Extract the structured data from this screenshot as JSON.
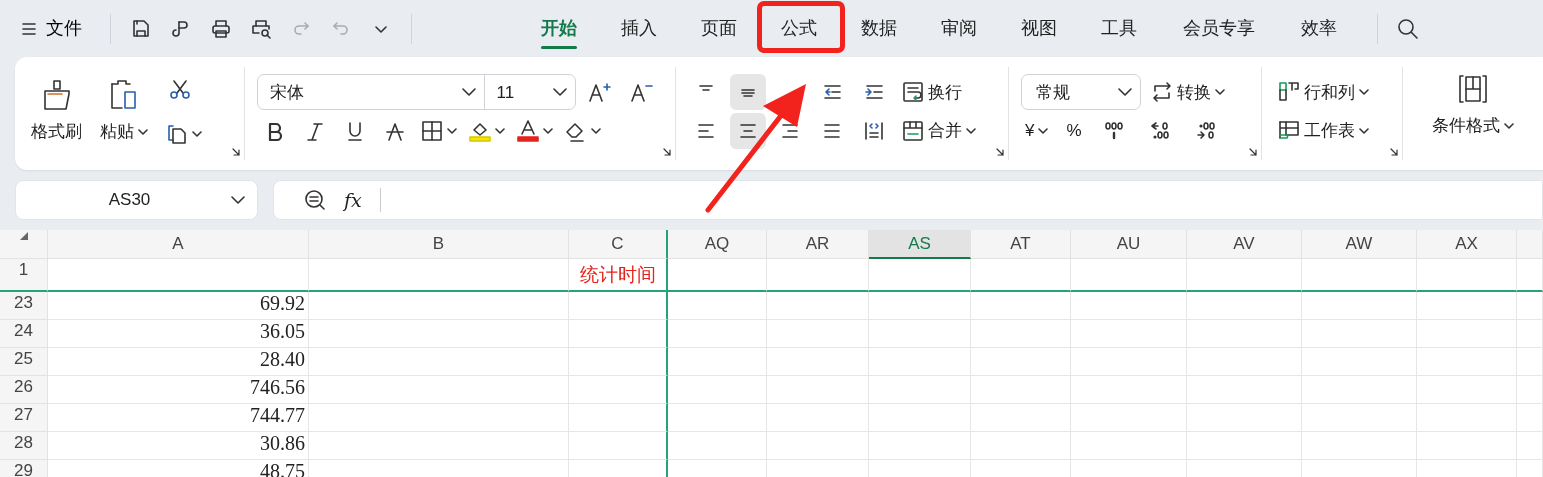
{
  "quick_access": {
    "menu_label": "文件",
    "tools": [
      {
        "kind": "save",
        "disabled": false
      },
      {
        "kind": "link",
        "disabled": false
      },
      {
        "kind": "print",
        "disabled": false
      },
      {
        "kind": "preview",
        "disabled": false
      },
      {
        "kind": "redo",
        "disabled": true
      },
      {
        "kind": "undo",
        "disabled": true
      },
      {
        "kind": "more",
        "disabled": false
      }
    ]
  },
  "tabs": [
    {
      "label": "开始",
      "selected": true,
      "highlighted": false
    },
    {
      "label": "插入",
      "selected": false,
      "highlighted": false
    },
    {
      "label": "页面",
      "selected": false,
      "highlighted": false
    },
    {
      "label": "公式",
      "selected": false,
      "highlighted": true
    },
    {
      "label": "数据",
      "selected": false,
      "highlighted": false
    },
    {
      "label": "审阅",
      "selected": false,
      "highlighted": false
    },
    {
      "label": "视图",
      "selected": false,
      "highlighted": false
    },
    {
      "label": "工具",
      "selected": false,
      "highlighted": false
    },
    {
      "label": "会员专享",
      "selected": false,
      "highlighted": false
    },
    {
      "label": "效率",
      "selected": false,
      "highlighted": false
    }
  ],
  "annotation_arrow": true,
  "clipboard": {
    "format_painter": "格式刷",
    "paste": "粘贴"
  },
  "font": {
    "name": "宋体",
    "size": "11"
  },
  "alignment": {
    "row_1": [
      {
        "kind": "top",
        "selected": false
      },
      {
        "kind": "middle",
        "selected": true
      },
      {
        "kind": "outdent",
        "selected": false
      },
      {
        "kind": "indent",
        "selected": false
      }
    ],
    "row_2": [
      {
        "kind": "left",
        "selected": false
      },
      {
        "kind": "center",
        "selected": true
      },
      {
        "kind": "right",
        "selected": false
      },
      {
        "kind": "justify",
        "selected": false
      },
      {
        "kind": "distributed",
        "selected": false
      }
    ],
    "wrap": "换行",
    "merge": "合并"
  },
  "number": {
    "format": "常规",
    "convert": "转换",
    "currency": "¥",
    "percent": "%"
  },
  "cells": {
    "rows_and_columns": "行和列",
    "worksheet": "工作表"
  },
  "styles": {
    "conditional_format": "条件格式"
  },
  "name_box": {
    "value": "AS30"
  },
  "formula_bar": {
    "label": "fx"
  },
  "sheet": {
    "columns": [
      {
        "label": "A",
        "selected": false
      },
      {
        "label": "B",
        "selected": false
      },
      {
        "label": "C",
        "selected": false
      },
      {
        "label": "AQ",
        "selected": false
      },
      {
        "label": "AR",
        "selected": false
      },
      {
        "label": "AS",
        "selected": true
      },
      {
        "label": "AT",
        "selected": false
      },
      {
        "label": "AU",
        "selected": false
      },
      {
        "label": "AV",
        "selected": false
      },
      {
        "label": "AW",
        "selected": false
      },
      {
        "label": "AX",
        "selected": false
      }
    ],
    "rows": [
      {
        "label": "1",
        "kind": "title",
        "cells": [
          "",
          "",
          "统计时间"
        ]
      },
      {
        "label": "23",
        "kind": "number",
        "cells": [
          "69.92"
        ]
      },
      {
        "label": "24",
        "kind": "number",
        "cells": [
          "36.05"
        ]
      },
      {
        "label": "25",
        "kind": "number",
        "cells": [
          "28.40"
        ]
      },
      {
        "label": "26",
        "kind": "number",
        "cells": [
          "746.56"
        ]
      },
      {
        "label": "27",
        "kind": "number",
        "cells": [
          "744.77"
        ]
      },
      {
        "label": "28",
        "kind": "number",
        "cells": [
          "30.86"
        ]
      },
      {
        "label": "29",
        "kind": "number",
        "cells": [
          "48.75"
        ]
      }
    ]
  }
}
